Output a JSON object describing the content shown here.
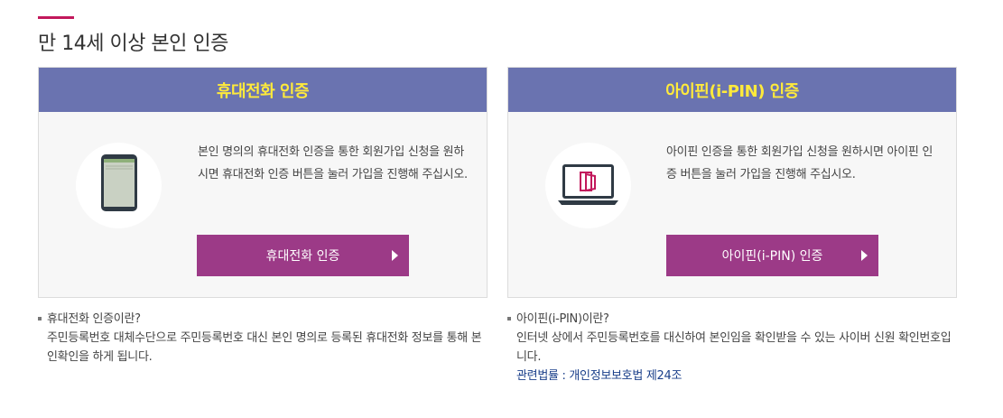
{
  "page": {
    "title": "만 14세 이상 본인 인증"
  },
  "phone_card": {
    "header": "휴대전화 인증",
    "icon": "smartphone-icon",
    "description": "본인 명의의 휴대전화 인증을 통한 회원가입 신청을 원하시면 휴대전화 인증 버튼을 눌러 가입을 진행해 주십시오.",
    "button_label": "휴대전화 인증",
    "info_title": "휴대전화 인증이란?",
    "info_body": "주민등록번호 대체수단으로 주민등록번호 대신 본인 명의로 등록된 휴대전화 정보를 통해 본인확인을 하게 됩니다."
  },
  "ipin_card": {
    "header": "아이핀(i-PIN) 인증",
    "icon": "laptop-ipin-icon",
    "description": "아이핀 인증을 통한 회원가입 신청을 원하시면 아이핀 인증 버튼을 눌러 가입을 진행해 주십시오.",
    "button_label": "아이핀(i-PIN) 인증",
    "info_title": "아이핀(i-PIN)이란?",
    "info_body": "인터넷 상에서 주민등록번호를 대신하여 본인임을 확인받을 수 있는 사이버 신원 확인번호입니다.",
    "law_link": "관련법률 : 개인정보보호법 제24조"
  },
  "colors": {
    "header_bg": "#6a73b0",
    "header_text": "#ffea3b",
    "button_bg": "#9c3a87",
    "accent": "#c2185b",
    "link": "#1a3f8a"
  }
}
